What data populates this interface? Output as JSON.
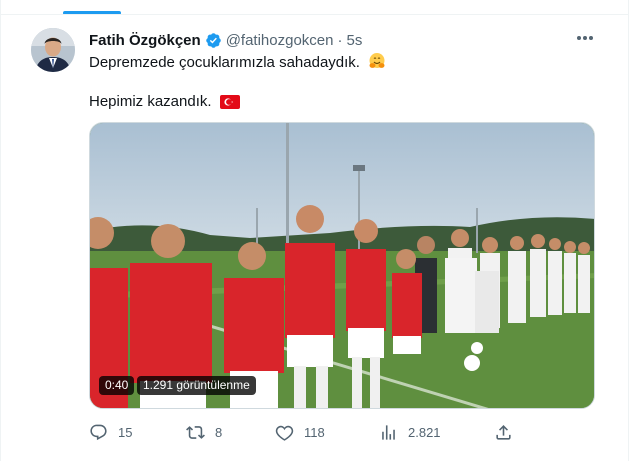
{
  "tweet": {
    "author_name": "Fatih Özgökçen",
    "handle": "@fatihozgokcen",
    "separator": "·",
    "timestamp": "5s",
    "text_line_1": "Depremzede çocuklarımızla sahadaydık.",
    "text_line_2": "Hepimiz kazandık.",
    "emoji_1": "hugging-face-emoji",
    "emoji_2": "turkey-flag-emoji"
  },
  "video": {
    "duration": "0:40",
    "views_label": "1.291 görüntülenme"
  },
  "actions": {
    "replies": "15",
    "retweets": "8",
    "likes": "118",
    "views": "2.821"
  },
  "colors": {
    "accent": "#1d9bf0",
    "text_primary": "#0f1419",
    "text_secondary": "#536471",
    "border": "#cfd9de",
    "jersey_red": "#d9252b",
    "turkey_red": "#e30a17"
  },
  "icons": [
    "verified-badge-icon",
    "more-icon",
    "reply-icon",
    "retweet-icon",
    "like-icon",
    "views-icon",
    "share-icon"
  ]
}
